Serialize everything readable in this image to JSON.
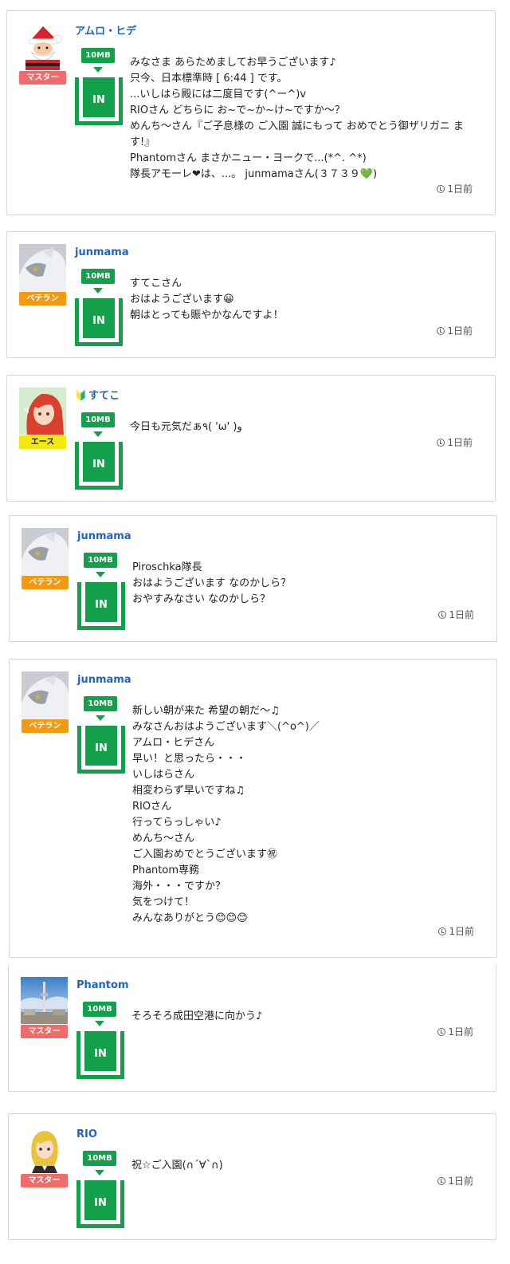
{
  "posts": [
    {
      "username": "アムロ・ヒデ",
      "rank": "マスター",
      "size": "10MB",
      "status": "IN",
      "avatar": "santa-avatar",
      "message": "みなさま あらためましてお早うございます♪\n只今、日本標準時 [ 6:44 ] です。\n...いしはら殿には二度目です(^ー^)v\nRIOさん どちらに お~で~か~け~ですか～？\nめんち～さん『ご子息様の ご入園 誠にもって おめでとう御ザリガニ ます!』\nPhantomさん まさかニュー・ヨークで...(*^. ^*)\n隊長アモーレ❤は、...。 junmamaさん(３７３９💚)",
      "time": "1日前"
    },
    {
      "username": "junmama",
      "rank": "ベテラン",
      "size": "10MB",
      "status": "IN",
      "avatar": "wolf-avatar",
      "message": "すてこさん\nおはようございます😀\n朝はとっても賑やかなんですよ！",
      "time": "1日前"
    },
    {
      "username": "すてこ",
      "rank": "エース",
      "size": "10MB",
      "status": "IN",
      "avatar": "redhair-girl-avatar",
      "message": "今日も元気だぁ٩( 'ω' )و",
      "time": "1日前"
    },
    {
      "username": "junmama",
      "rank": "ベテラン",
      "size": "10MB",
      "status": "IN",
      "avatar": "wolf-avatar",
      "message": "Piroschka隊長\nおはようございます なのかしら？\nおやすみなさい なのかしら？",
      "time": "1日前"
    },
    {
      "username": "junmama",
      "rank": "ベテラン",
      "size": "10MB",
      "status": "IN",
      "avatar": "wolf-avatar",
      "message": "新しい朝が来た 希望の朝だ～♫\nみなさんおはようございます＼(^o^)／\nアムロ・ヒデさん\n早い！と思ったら・・・\nいしはらさん\n相変わらず早いですね♫\nRIOさん\n行ってらっしゃい♪\nめんち～さん\nご入園おめでとうございます㊗\nPhantom専務\n海外・・・ですか？\n気をつけて！\nみんなありがとう😊😊😊",
      "time": "1日前"
    },
    {
      "username": "Phantom",
      "rank": "マスター",
      "size": "10MB",
      "status": "IN",
      "avatar": "tower-photo-avatar",
      "message": "そろそろ成田空港に向かう♪",
      "time": "1日前"
    },
    {
      "username": "RIO",
      "rank": "マスター",
      "size": "10MB",
      "status": "IN",
      "avatar": "blonde-girl-avatar",
      "message": "祝☆ご入園(∩´∀`∩)",
      "time": "1日前"
    }
  ],
  "colors": {
    "master": "#f26b6b",
    "veteran": "#f39a12",
    "ace": "#f2ea0e",
    "accent_green": "#13a04a",
    "username_blue": "#1f63c6"
  },
  "beginner_icon": "beginner-mark-icon",
  "clock_icon": "clock-icon"
}
